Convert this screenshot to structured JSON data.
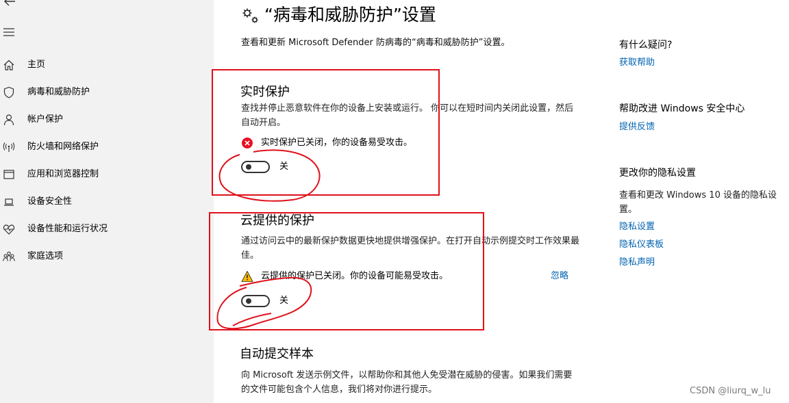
{
  "sidebar": {
    "items": [
      {
        "label": "主页",
        "icon": "home-icon"
      },
      {
        "label": "病毒和威胁防护",
        "icon": "shield-icon"
      },
      {
        "label": "帐户保护",
        "icon": "person-icon"
      },
      {
        "label": "防火墙和网络保护",
        "icon": "wifi-antenna-icon"
      },
      {
        "label": "应用和浏览器控制",
        "icon": "app-window-icon"
      },
      {
        "label": "设备安全性",
        "icon": "laptop-icon"
      },
      {
        "label": "设备性能和运行状况",
        "icon": "heart-pulse-icon"
      },
      {
        "label": "家庭选项",
        "icon": "family-icon"
      }
    ]
  },
  "page": {
    "title": "“病毒和威胁防护”设置",
    "subtitle": "查看和更新 Microsoft Defender 防病毒的“病毒和威胁防护”设置。"
  },
  "realtime": {
    "title": "实时保护",
    "description": "查找并停止恶意软件在你的设备上安装或运行。 你可以在短时间内关闭此设置，然后自动开启。",
    "status": "实时保护已关闭，你的设备易受攻击。",
    "toggle_label": "关",
    "toggle_on": false
  },
  "cloud": {
    "title": "云提供的保护",
    "description": "通过访问云中的最新保护数据更快地提供增强保护。在打开自动示例提交时工作效果最佳。",
    "status": "云提供的保护已关闭。你的设备可能易受攻击。",
    "ignore_label": "忽略",
    "toggle_label": "关",
    "toggle_on": false
  },
  "samples": {
    "title": "自动提交样本",
    "description": "向 Microsoft 发送示例文件，以帮助你和其他人免受潜在威胁的侵害。如果我们需要的文件可能包含个人信息，我们将对你进行提示。"
  },
  "aside": {
    "question_heading": "有什么疑问?",
    "get_help": "获取帮助",
    "improve_heading": "帮助改进 Windows 安全中心",
    "feedback": "提供反馈",
    "privacy_heading": "更改你的隐私设置",
    "privacy_text": "查看和更改 Windows 10 设备的隐私设置。",
    "privacy_settings": "隐私设置",
    "privacy_dashboard": "隐私仪表板",
    "privacy_statement": "隐私声明"
  },
  "watermark": "CSDN @liurq_w_lu",
  "colors": {
    "error": "#e81123",
    "warning": "#ffb900",
    "link": "#0063b1",
    "annotation": "#e0101a"
  }
}
